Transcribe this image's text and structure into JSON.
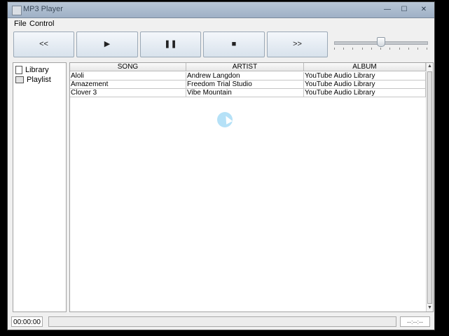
{
  "window": {
    "title": "MP3 Player",
    "controls": {
      "minimize": "—",
      "maximize": "☐",
      "close": "✕"
    }
  },
  "menu": {
    "file": "File",
    "control": "Control"
  },
  "toolbar": {
    "prev": "<<",
    "play": "▶",
    "pause": "❚❚",
    "stop": "■",
    "next": ">>",
    "volume_level": 0.5
  },
  "tree": {
    "library": "Library",
    "playlist": "Playlist"
  },
  "table": {
    "columns": [
      "SONG",
      "ARTIST",
      "ALBUM"
    ],
    "rows": [
      {
        "song": "Aloli",
        "artist": "Andrew Langdon",
        "album": "YouTube Audio Library"
      },
      {
        "song": "Amazement",
        "artist": "Freedom Trial Studio",
        "album": "YouTube Audio Library"
      },
      {
        "song": "Clover 3",
        "artist": "Vibe Mountain",
        "album": "YouTube Audio Library"
      }
    ]
  },
  "status": {
    "elapsed": "00:00:00",
    "remaining": "--:--:--",
    "progress": 0
  },
  "icons": {
    "library": "file-icon",
    "playlist": "folder-icon",
    "app": "app-icon"
  }
}
